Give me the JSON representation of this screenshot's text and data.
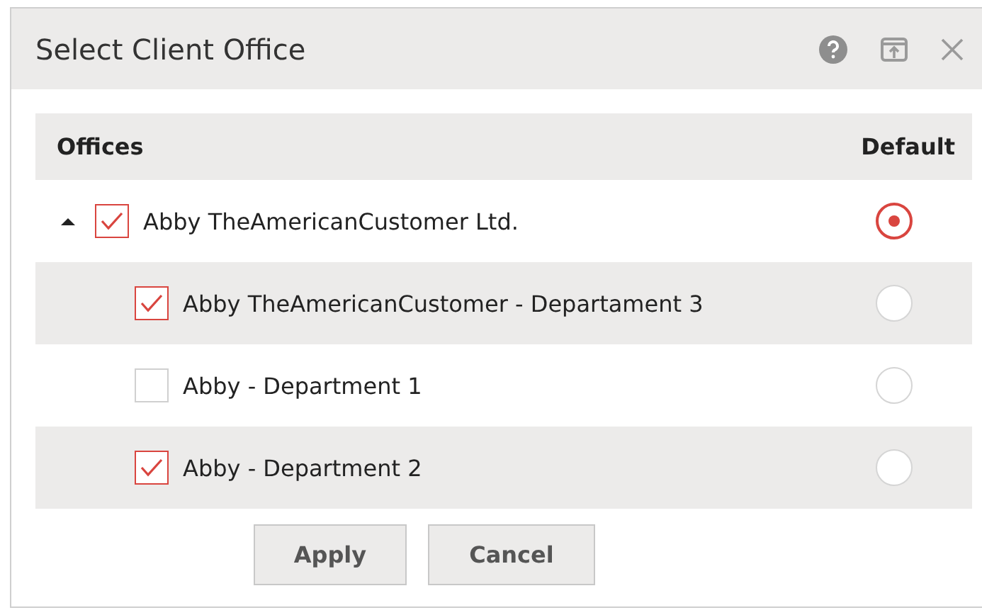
{
  "window": {
    "title": "Select Client Office"
  },
  "table": {
    "columns": [
      "Offices",
      "Default"
    ],
    "rows": [
      {
        "label": "Abby TheAmericanCustomer Ltd.",
        "expanded": true,
        "checked": true,
        "selected": true,
        "children": [
          {
            "label": "Abby TheAmericanCustomer - Departament 3",
            "checked": true,
            "selected": false
          },
          {
            "label": "Abby - Department 1",
            "checked": false,
            "selected": false
          },
          {
            "label": "Abby - Department 2",
            "checked": true,
            "selected": false
          }
        ]
      }
    ]
  },
  "buttons": [
    "Apply",
    "Cancel"
  ]
}
